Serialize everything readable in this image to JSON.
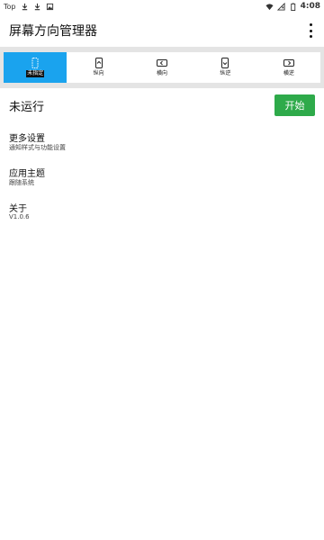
{
  "statusbar": {
    "carrier": "Top",
    "time": "4:08"
  },
  "appbar": {
    "title": "屏幕方向管理器",
    "overflow_icon": "more-vert-icon"
  },
  "modes": [
    {
      "label": "未指定",
      "icon": "unspecified-icon",
      "active": true
    },
    {
      "label": "纵向",
      "icon": "portrait-icon",
      "active": false
    },
    {
      "label": "横向",
      "icon": "landscape-icon",
      "active": false
    },
    {
      "label": "纵逆",
      "icon": "reverse-portrait-icon",
      "active": false
    },
    {
      "label": "横逆",
      "icon": "reverse-landscape-icon",
      "active": false
    }
  ],
  "status": {
    "text": "未运行",
    "start_label": "开始"
  },
  "settings": [
    {
      "title": "更多设置",
      "subtitle": "通知样式与功能设置"
    },
    {
      "title": "应用主题",
      "subtitle": "跟随系统"
    },
    {
      "title": "关于",
      "subtitle": "V1.0.6"
    }
  ],
  "colors": {
    "accent": "#1aa3ee",
    "start_button": "#2eaa4a"
  }
}
